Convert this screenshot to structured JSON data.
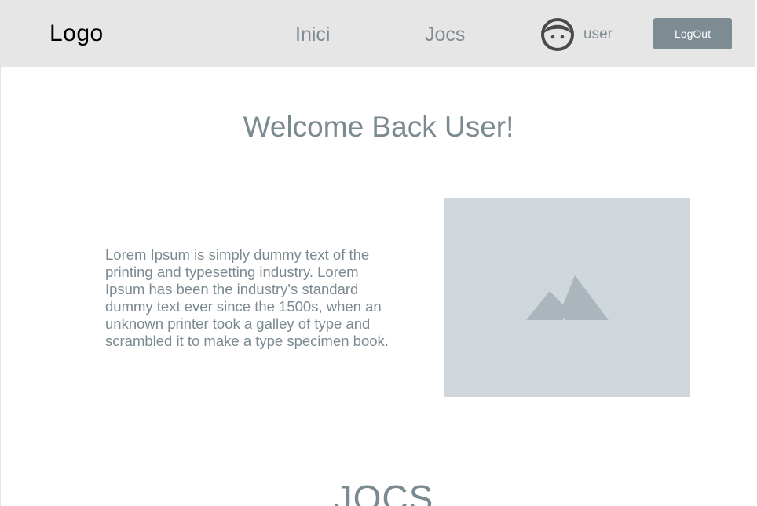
{
  "header": {
    "logo": "Logo",
    "nav": [
      {
        "label": "Inici"
      },
      {
        "label": "Jocs"
      }
    ],
    "user": {
      "name": "user",
      "avatar_icon": "face-avatar-icon"
    },
    "logout_label": "LogOut"
  },
  "main": {
    "welcome": "Welcome Back User!",
    "intro": "Lorem Ipsum is simply dummy text of the printing and typesetting industry. Lorem Ipsum has been the industry's standard dummy text ever since the 1500s, when an unknown printer took a galley of type and scrambled it to make a type specimen book.",
    "image_icon": "mountain-image-icon",
    "section_title": "JOCS"
  },
  "colors": {
    "navbar_bg": "#e6e6e6",
    "accent_text": "#7b8a91",
    "button_bg": "#7d8b92",
    "placeholder_bg": "#cfd7dd",
    "placeholder_icon": "#aab6bc"
  }
}
